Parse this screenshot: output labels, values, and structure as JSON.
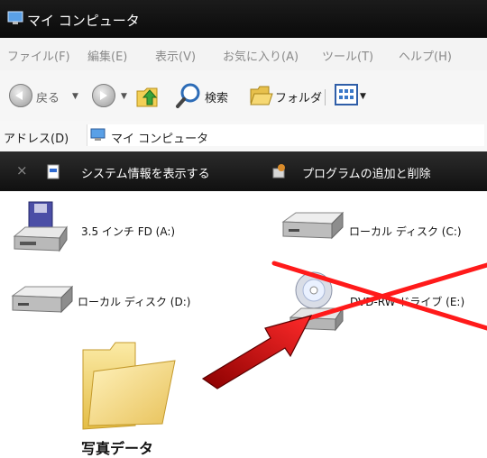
{
  "window": {
    "title": "マイ コンピュータ"
  },
  "menu": [
    "ファイル(F)",
    "編集(E)",
    "表示(V)",
    "お気に入り(A)",
    "ツール(T)",
    "ヘルプ(H)"
  ],
  "toolbar": {
    "back_label": "戻る",
    "search_label": "検索",
    "folders_label": "フォルダ"
  },
  "address": {
    "label": "アドレス(D)",
    "value": "マイ コンピュータ"
  },
  "tasks": {
    "close": "×",
    "system_info": "システム情報を表示する",
    "add_remove": "プログラムの追加と削除"
  },
  "drives": [
    {
      "label": "3.5 インチ FD (A:)",
      "icon": "floppy-drive-icon"
    },
    {
      "label": "ローカル ディスク (C:)",
      "icon": "hard-disk-icon"
    },
    {
      "label": "ローカル ディスク (D:)",
      "icon": "hard-disk-icon"
    },
    {
      "label": "DVD-RW ドライブ (E:)",
      "icon": "dvd-drive-icon"
    }
  ],
  "folder": {
    "label": "写真データ",
    "icon": "folder-icon"
  },
  "annotation": {
    "cross_color": "#ff1a1a",
    "arrow_color": "#e00000"
  }
}
